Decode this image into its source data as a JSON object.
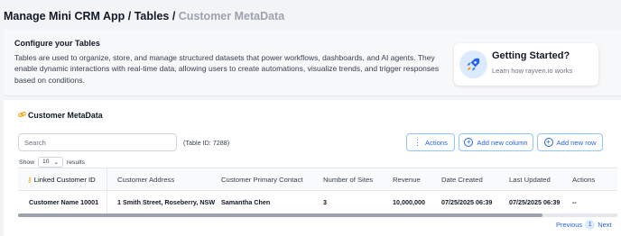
{
  "breadcrumb": {
    "app": "Manage Mini CRM App",
    "sep1": " / ",
    "tables": "Tables",
    "sep2": " / ",
    "current": "Customer MetaData"
  },
  "config": {
    "title": "Configure your Tables",
    "description": "Tables are used to organize, store, and manage structured datasets that power workflows, dashboards, and AI agents. They enable dynamic interactions with real-time data, allowing users to create automations, visualize trends, and trigger responses based on conditions."
  },
  "getting_started": {
    "title": "Getting Started?",
    "subtitle": "Learn how rayven.io works",
    "icon": "rocket-icon"
  },
  "section": {
    "title": "Customer MetaData",
    "icon": "link-icon"
  },
  "toolbar": {
    "search_placeholder": "Search",
    "table_id": "(Table ID: 7288)",
    "actions_label": "Actions",
    "add_column_label": "Add new column",
    "add_row_label": "Add new row"
  },
  "show": {
    "label": "Show",
    "value": "10",
    "suffix": "results"
  },
  "table": {
    "headers": [
      "Linked Customer ID",
      "Customer Address",
      "Customer Primary Contact",
      "Number of Sites",
      "Revenue",
      "Date Created",
      "Last Updated",
      "Actions"
    ],
    "rows": [
      [
        "Customer Name 10001",
        "1 Smith Street, Roseberry, NSW",
        "Samantha Chen",
        "3",
        "10,000,000",
        "07/25/2025 06:39",
        "07/25/2025 06:39",
        "--"
      ]
    ]
  },
  "pager": {
    "previous": "Previous",
    "current": "1",
    "next": "Next"
  },
  "colors": {
    "accent": "#2563eb",
    "accent_light": "#dbeafe",
    "key_icon": "#f59e0b"
  }
}
